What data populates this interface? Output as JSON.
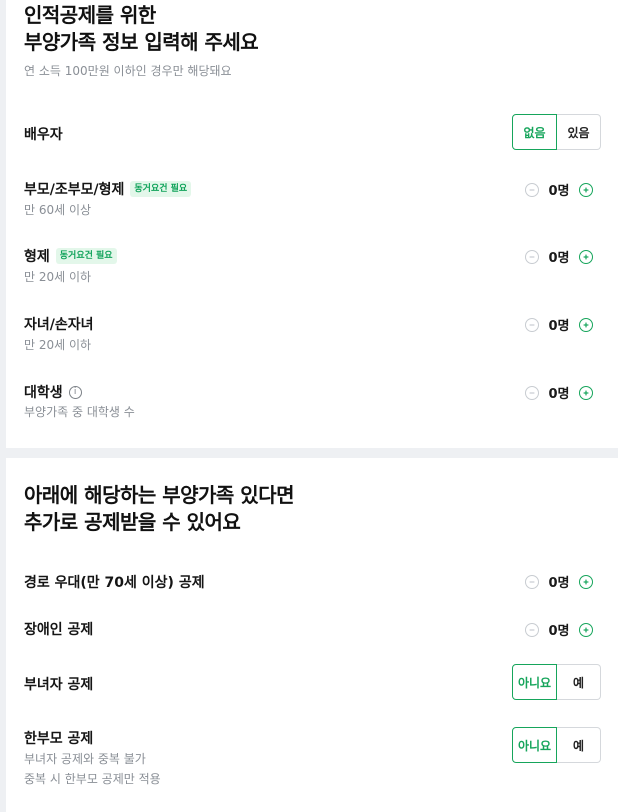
{
  "section1": {
    "title_line1": "인적공제를 위한",
    "title_line2": "부양가족 정보 입력해 주세요",
    "subtitle": "연 소득 100만원 이하인 경우만 해당돼요",
    "spouse": {
      "label": "배우자",
      "option_selected": "없음",
      "option_other": "있음"
    },
    "parents": {
      "label": "부모/조부모/형제",
      "badge": "동거요건 필요",
      "desc": "만 60세 이상",
      "count": "0명"
    },
    "siblings": {
      "label": "형제",
      "badge": "동거요건 필요",
      "desc": "만 20세 이하",
      "count": "0명"
    },
    "children": {
      "label": "자녀/손자녀",
      "desc": "만 20세 이하",
      "count": "0명"
    },
    "students": {
      "label": "대학생",
      "info": "i",
      "desc": "부양가족 중 대학생 수",
      "count": "0명"
    }
  },
  "section2": {
    "title_line1": "아래에 해당하는 부양가족 있다면",
    "title_line2": "추가로 공제받을 수 있어요",
    "elderly": {
      "label": "경로 우대(만 70세 이상) 공제",
      "count": "0명"
    },
    "disabled": {
      "label": "장애인 공제",
      "count": "0명"
    },
    "female_head": {
      "label": "부녀자 공제",
      "option_selected": "아니요",
      "option_other": "예"
    },
    "single_parent": {
      "label": "한부모 공제",
      "desc_line1": "부녀자 공제와 중복 불가",
      "desc_line2": "중복 시 한부모 공제만 적용",
      "option_selected": "아니요",
      "option_other": "예"
    }
  },
  "colors": {
    "accent": "#16a55b",
    "badge_bg": "#e3f7ea",
    "muted": "#8a8f96",
    "divider": "#eef0f3"
  }
}
